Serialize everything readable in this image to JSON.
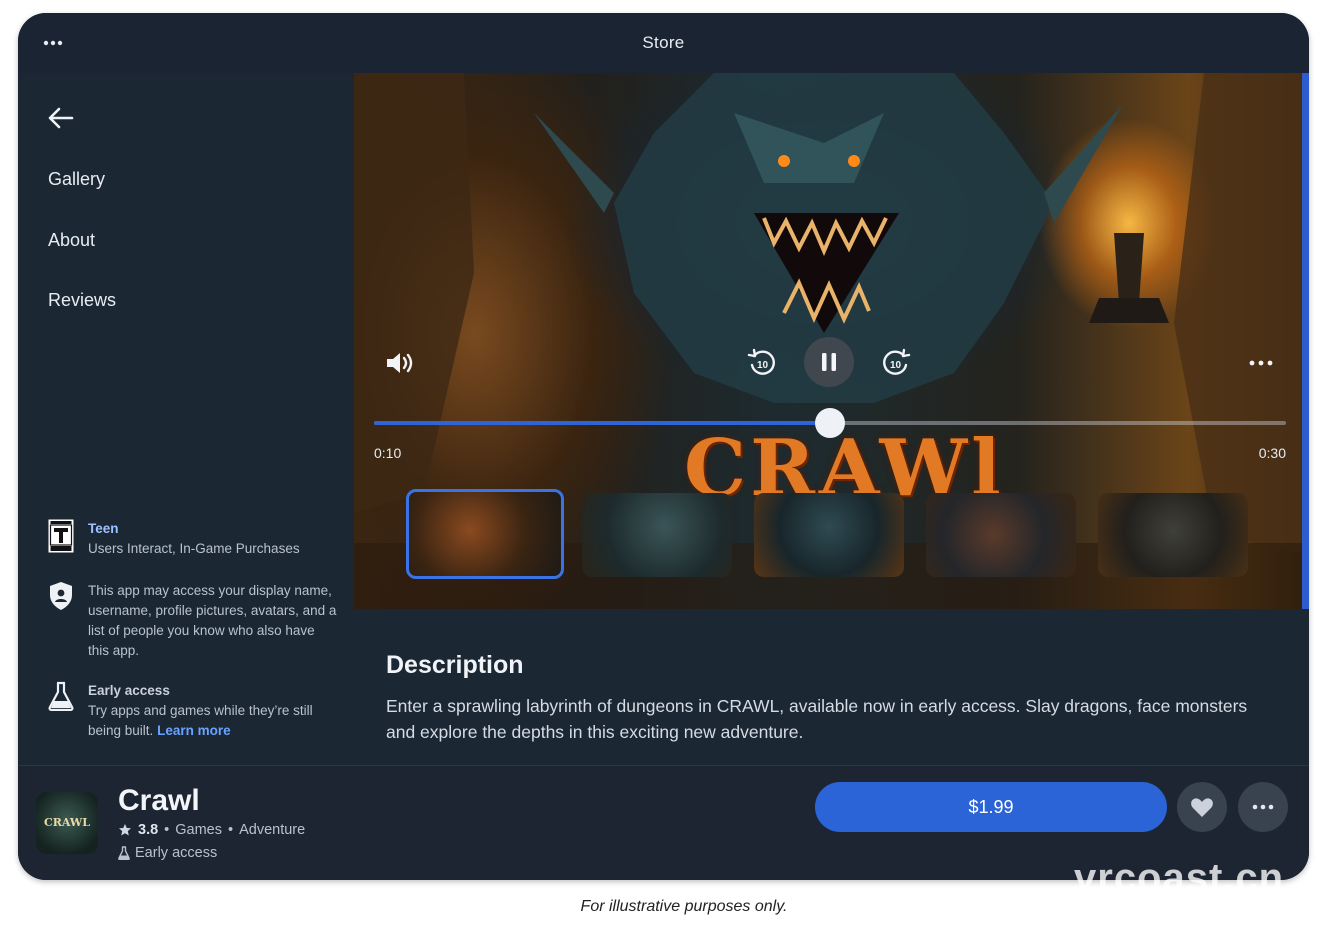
{
  "window": {
    "title": "Store"
  },
  "sidebar": {
    "nav": [
      "Gallery",
      "About",
      "Reviews"
    ],
    "rating_block": {
      "heading": "Teen",
      "detail": "Users Interact, In-Game Purchases",
      "icon": "esrb-teen-icon"
    },
    "privacy_block": {
      "text": "This app may access your display name, username, profile pictures, avatars, and a list of people you know who also have this app.",
      "icon": "shield-icon"
    },
    "early_access_block": {
      "heading": "Early access",
      "text": "Try apps and games while they’re still being built.",
      "link": "Learn more",
      "icon": "flask-icon"
    }
  },
  "video": {
    "logo_text": "CRAWl",
    "current_time": "0:10",
    "total_time": "0:30",
    "progress": 0.5,
    "rewind_seconds": "10",
    "forward_seconds": "10"
  },
  "thumbnails": [
    {
      "selected": true
    },
    {
      "selected": false
    },
    {
      "selected": false
    },
    {
      "selected": false
    },
    {
      "selected": false
    }
  ],
  "description": {
    "title": "Description",
    "body": "Enter a sprawling labyrinth of dungeons in CRAWL, available now in early access. Slay dragons, face monsters and explore the depths in this exciting new adventure."
  },
  "app": {
    "name": "Crawl",
    "icon_text": "CRAWL",
    "rating": "3.8",
    "category": "Games",
    "genre": "Adventure",
    "separator": "•",
    "status": "Early access",
    "price": "$1.99"
  },
  "caption": "For illustrative purposes only.",
  "watermark": "vrcoast.cn",
  "colors": {
    "accent": "#2a64d6",
    "background": "#1c2734",
    "link": "#6aa2ff"
  }
}
